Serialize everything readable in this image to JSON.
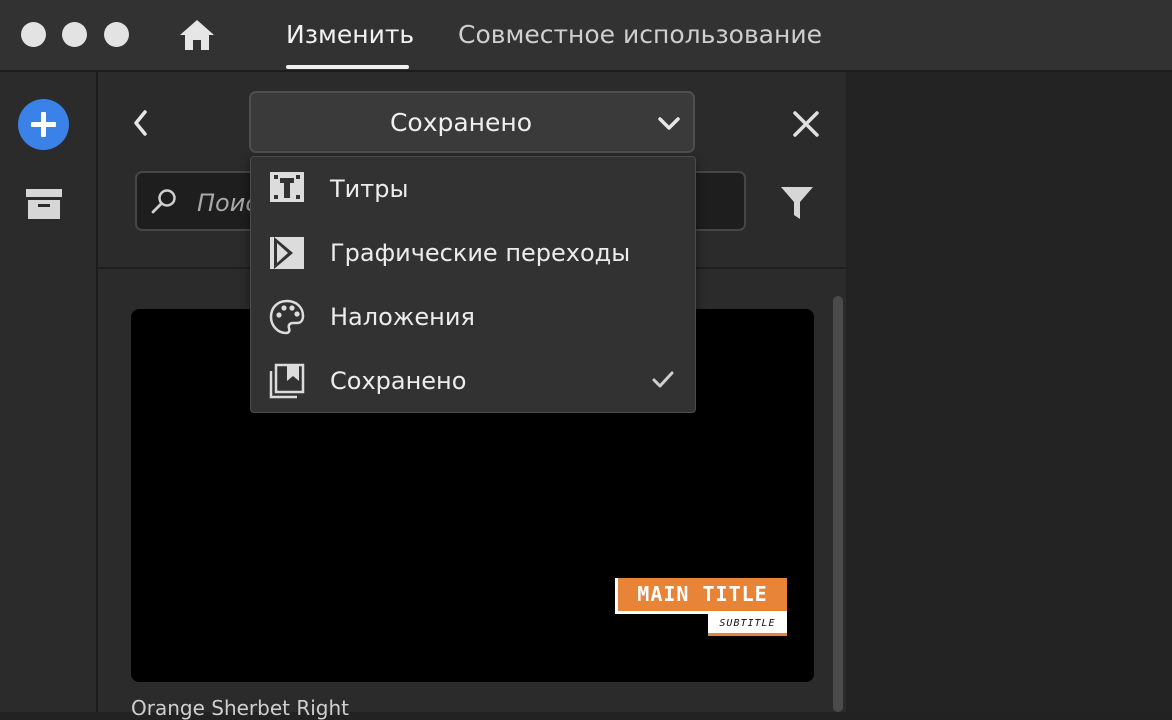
{
  "window": {
    "controls": [
      "close-dot",
      "minimize-dot",
      "zoom-dot"
    ]
  },
  "header": {
    "home_icon": "home-icon",
    "tabs": [
      {
        "label": "Изменить",
        "active": true
      },
      {
        "label": "Совместное использование",
        "active": false
      }
    ]
  },
  "left_rail": {
    "add_icon": "plus-icon",
    "archive_icon": "archive-icon"
  },
  "panel": {
    "back_icon": "chevron-left-icon",
    "close_icon": "close-icon",
    "dropdown": {
      "selected": "Сохранено",
      "chevron_icon": "chevron-down-icon"
    },
    "search": {
      "placeholder": "Поиск",
      "value": ""
    },
    "filter_icon": "filter-icon",
    "menu": {
      "items": [
        {
          "label": "Титры",
          "icon": "titles-icon",
          "selected": false
        },
        {
          "label": "Графические переходы",
          "icon": "transition-icon",
          "selected": false
        },
        {
          "label": "Наложения",
          "icon": "palette-icon",
          "selected": false
        },
        {
          "label": "Сохранено",
          "icon": "saved-icon",
          "selected": true
        }
      ]
    },
    "preview": {
      "main_title": "MAIN TITLE",
      "subtitle": "SUBTITLE",
      "caption": "Orange Sherbet Right"
    }
  },
  "colors": {
    "accent_blue": "#3b82e8",
    "lower_third_orange": "#e88438",
    "background": "#222222",
    "panel": "#2b2b2b",
    "menu": "#323232"
  }
}
